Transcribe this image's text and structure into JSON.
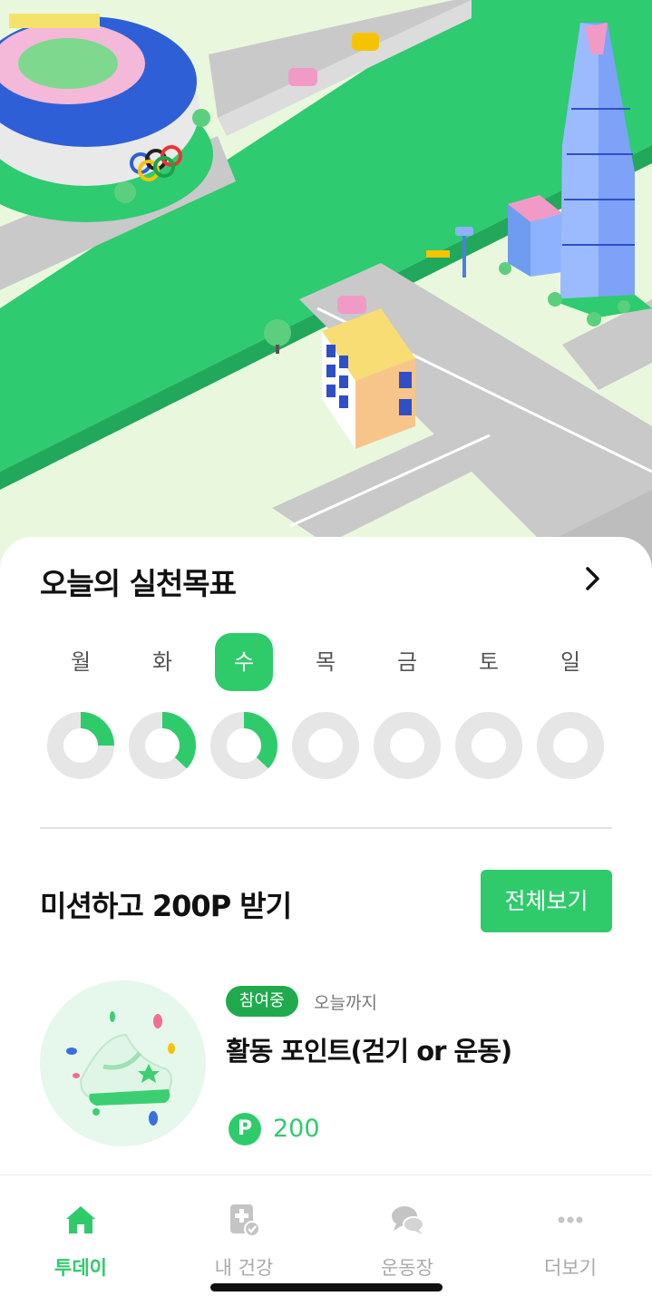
{
  "goal": {
    "title": "오늘의 실천목표",
    "days": [
      "월",
      "화",
      "수",
      "목",
      "금",
      "토",
      "일"
    ],
    "selected_day": "수",
    "progress": [
      0.25,
      0.37,
      0.37,
      0,
      0,
      0,
      0
    ]
  },
  "mission": {
    "title": "미션하고 200P 받기",
    "view_all_label": "전체보기",
    "item": {
      "status_badge": "참여중",
      "deadline": "오늘까지",
      "name": "활동 포인트(걷기 or 운동)",
      "point_symbol": "P",
      "points": "200"
    }
  },
  "nav": {
    "items": [
      {
        "label": "투데이",
        "icon": "home-icon",
        "active": true
      },
      {
        "label": "내 건강",
        "icon": "health-record-icon",
        "active": false
      },
      {
        "label": "운동장",
        "icon": "chat-bubbles-icon",
        "active": false
      },
      {
        "label": "더보기",
        "icon": "more-dots-icon",
        "active": false
      }
    ]
  },
  "colors": {
    "accent": "#2fcb6b",
    "ring_track": "#e6e6e6",
    "badge": "#1faa4e",
    "inactive": "#aaaaaa"
  }
}
